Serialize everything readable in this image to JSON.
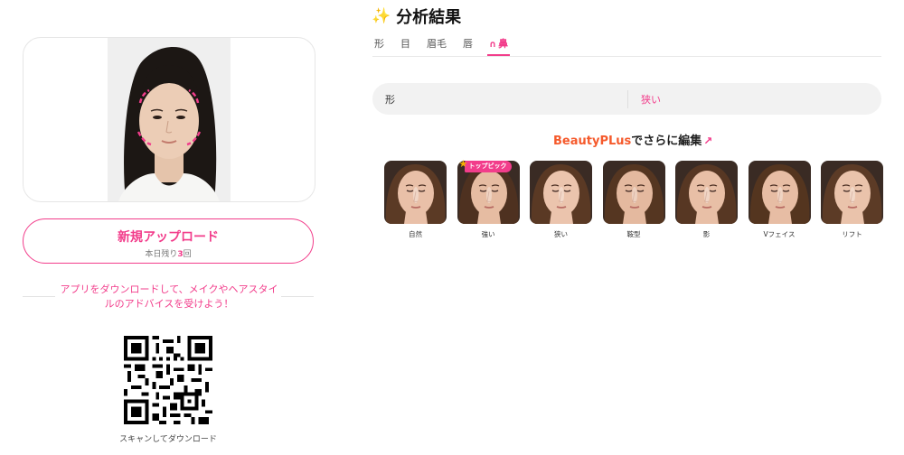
{
  "left": {
    "upload_button": {
      "label": "新規アップロード",
      "sub_prefix": "本日残り",
      "sub_count": "3",
      "sub_suffix": "回"
    },
    "promo_lines": [
      "アプリをダウンロードして、メイクやヘアスタイ",
      "ルのアドバイスを受けよう！"
    ],
    "qr_caption": "スキャンしてダウンロード"
  },
  "right": {
    "title": "分析結果",
    "title_icon": "sparkles-icon",
    "tabs": [
      {
        "label": "形",
        "active": false
      },
      {
        "label": "目",
        "active": false
      },
      {
        "label": "眉毛",
        "active": false
      },
      {
        "label": "唇",
        "active": false
      },
      {
        "label": "鼻",
        "active": true,
        "icon": "nose-icon"
      }
    ],
    "result": {
      "key": "形",
      "value": "狭い"
    },
    "edit_link": {
      "brand": "BeautyPLus",
      "text": "でさらに編集",
      "icon": "arrow-up-right-icon"
    },
    "styles": [
      {
        "label": "自然"
      },
      {
        "label": "強い",
        "badge": "トップピック"
      },
      {
        "label": "狭い"
      },
      {
        "label": "鞍型"
      },
      {
        "label": "影"
      },
      {
        "label": "Vフェイス"
      },
      {
        "label": "リフト"
      }
    ]
  },
  "colors": {
    "accent": "#f23d8b",
    "brand_orange": "#f55a2c",
    "pill_bg": "#f2f2f2"
  }
}
